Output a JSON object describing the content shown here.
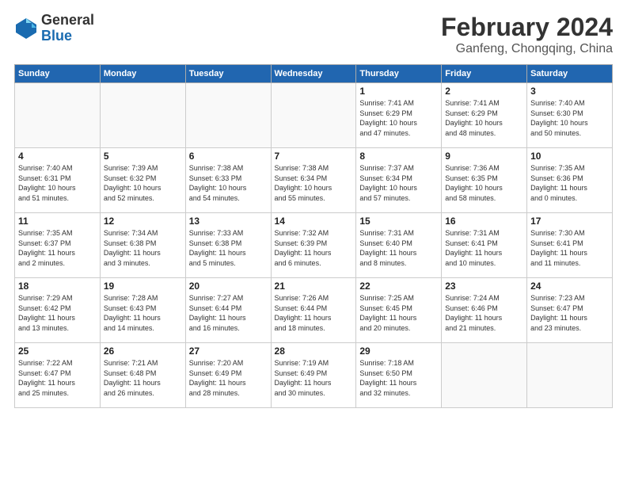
{
  "logo": {
    "general": "General",
    "blue": "Blue"
  },
  "title": "February 2024",
  "location": "Ganfeng, Chongqing, China",
  "headers": [
    "Sunday",
    "Monday",
    "Tuesday",
    "Wednesday",
    "Thursday",
    "Friday",
    "Saturday"
  ],
  "rows": [
    [
      {
        "num": "",
        "info": "",
        "empty": true
      },
      {
        "num": "",
        "info": "",
        "empty": true
      },
      {
        "num": "",
        "info": "",
        "empty": true
      },
      {
        "num": "",
        "info": "",
        "empty": true
      },
      {
        "num": "1",
        "info": "Sunrise: 7:41 AM\nSunset: 6:29 PM\nDaylight: 10 hours\nand 47 minutes.",
        "empty": false
      },
      {
        "num": "2",
        "info": "Sunrise: 7:41 AM\nSunset: 6:29 PM\nDaylight: 10 hours\nand 48 minutes.",
        "empty": false
      },
      {
        "num": "3",
        "info": "Sunrise: 7:40 AM\nSunset: 6:30 PM\nDaylight: 10 hours\nand 50 minutes.",
        "empty": false
      }
    ],
    [
      {
        "num": "4",
        "info": "Sunrise: 7:40 AM\nSunset: 6:31 PM\nDaylight: 10 hours\nand 51 minutes.",
        "empty": false
      },
      {
        "num": "5",
        "info": "Sunrise: 7:39 AM\nSunset: 6:32 PM\nDaylight: 10 hours\nand 52 minutes.",
        "empty": false
      },
      {
        "num": "6",
        "info": "Sunrise: 7:38 AM\nSunset: 6:33 PM\nDaylight: 10 hours\nand 54 minutes.",
        "empty": false
      },
      {
        "num": "7",
        "info": "Sunrise: 7:38 AM\nSunset: 6:34 PM\nDaylight: 10 hours\nand 55 minutes.",
        "empty": false
      },
      {
        "num": "8",
        "info": "Sunrise: 7:37 AM\nSunset: 6:34 PM\nDaylight: 10 hours\nand 57 minutes.",
        "empty": false
      },
      {
        "num": "9",
        "info": "Sunrise: 7:36 AM\nSunset: 6:35 PM\nDaylight: 10 hours\nand 58 minutes.",
        "empty": false
      },
      {
        "num": "10",
        "info": "Sunrise: 7:35 AM\nSunset: 6:36 PM\nDaylight: 11 hours\nand 0 minutes.",
        "empty": false
      }
    ],
    [
      {
        "num": "11",
        "info": "Sunrise: 7:35 AM\nSunset: 6:37 PM\nDaylight: 11 hours\nand 2 minutes.",
        "empty": false
      },
      {
        "num": "12",
        "info": "Sunrise: 7:34 AM\nSunset: 6:38 PM\nDaylight: 11 hours\nand 3 minutes.",
        "empty": false
      },
      {
        "num": "13",
        "info": "Sunrise: 7:33 AM\nSunset: 6:38 PM\nDaylight: 11 hours\nand 5 minutes.",
        "empty": false
      },
      {
        "num": "14",
        "info": "Sunrise: 7:32 AM\nSunset: 6:39 PM\nDaylight: 11 hours\nand 6 minutes.",
        "empty": false
      },
      {
        "num": "15",
        "info": "Sunrise: 7:31 AM\nSunset: 6:40 PM\nDaylight: 11 hours\nand 8 minutes.",
        "empty": false
      },
      {
        "num": "16",
        "info": "Sunrise: 7:31 AM\nSunset: 6:41 PM\nDaylight: 11 hours\nand 10 minutes.",
        "empty": false
      },
      {
        "num": "17",
        "info": "Sunrise: 7:30 AM\nSunset: 6:41 PM\nDaylight: 11 hours\nand 11 minutes.",
        "empty": false
      }
    ],
    [
      {
        "num": "18",
        "info": "Sunrise: 7:29 AM\nSunset: 6:42 PM\nDaylight: 11 hours\nand 13 minutes.",
        "empty": false
      },
      {
        "num": "19",
        "info": "Sunrise: 7:28 AM\nSunset: 6:43 PM\nDaylight: 11 hours\nand 14 minutes.",
        "empty": false
      },
      {
        "num": "20",
        "info": "Sunrise: 7:27 AM\nSunset: 6:44 PM\nDaylight: 11 hours\nand 16 minutes.",
        "empty": false
      },
      {
        "num": "21",
        "info": "Sunrise: 7:26 AM\nSunset: 6:44 PM\nDaylight: 11 hours\nand 18 minutes.",
        "empty": false
      },
      {
        "num": "22",
        "info": "Sunrise: 7:25 AM\nSunset: 6:45 PM\nDaylight: 11 hours\nand 20 minutes.",
        "empty": false
      },
      {
        "num": "23",
        "info": "Sunrise: 7:24 AM\nSunset: 6:46 PM\nDaylight: 11 hours\nand 21 minutes.",
        "empty": false
      },
      {
        "num": "24",
        "info": "Sunrise: 7:23 AM\nSunset: 6:47 PM\nDaylight: 11 hours\nand 23 minutes.",
        "empty": false
      }
    ],
    [
      {
        "num": "25",
        "info": "Sunrise: 7:22 AM\nSunset: 6:47 PM\nDaylight: 11 hours\nand 25 minutes.",
        "empty": false
      },
      {
        "num": "26",
        "info": "Sunrise: 7:21 AM\nSunset: 6:48 PM\nDaylight: 11 hours\nand 26 minutes.",
        "empty": false
      },
      {
        "num": "27",
        "info": "Sunrise: 7:20 AM\nSunset: 6:49 PM\nDaylight: 11 hours\nand 28 minutes.",
        "empty": false
      },
      {
        "num": "28",
        "info": "Sunrise: 7:19 AM\nSunset: 6:49 PM\nDaylight: 11 hours\nand 30 minutes.",
        "empty": false
      },
      {
        "num": "29",
        "info": "Sunrise: 7:18 AM\nSunset: 6:50 PM\nDaylight: 11 hours\nand 32 minutes.",
        "empty": false
      },
      {
        "num": "",
        "info": "",
        "empty": true
      },
      {
        "num": "",
        "info": "",
        "empty": true
      }
    ]
  ]
}
